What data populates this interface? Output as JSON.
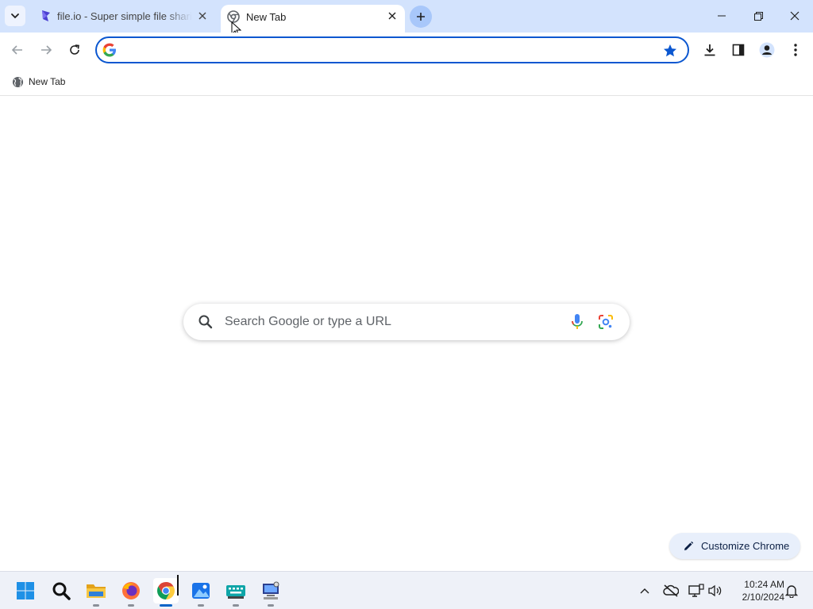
{
  "browser": {
    "tabs": [
      {
        "title": "file.io - Super simple file sharing",
        "active": false,
        "favicon": "fileio-icon"
      },
      {
        "title": "New Tab",
        "active": true,
        "favicon": "chrome-icon"
      }
    ],
    "omnibox": {
      "value": "",
      "placeholder": ""
    },
    "bookmarks": [
      {
        "label": "New Tab",
        "icon": "globe-icon"
      }
    ]
  },
  "newtab": {
    "search_placeholder": "Search Google or type a URL",
    "customize_label": "Customize Chrome"
  },
  "taskbar": {
    "apps": [
      "start",
      "search",
      "file-explorer",
      "firefox",
      "chrome",
      "photos",
      "keyboard-app",
      "network-app"
    ],
    "active_app": "chrome",
    "time": "10:24 AM",
    "date": "2/10/2024"
  },
  "colors": {
    "tabstrip": "#d3e3fd",
    "accent": "#0b57d0",
    "taskbar": "#eef1f8"
  }
}
